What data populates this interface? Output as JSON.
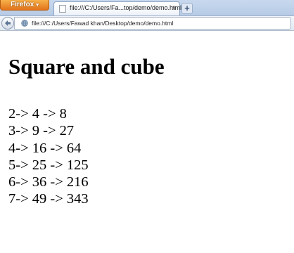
{
  "browser": {
    "menu_button": {
      "label": "Firefox",
      "arrow": "▾",
      "color": "#e8821f"
    },
    "tabs": [
      {
        "label": "file:///C:/Users/Fa...top/demo/demo.html",
        "close_glyph": "×",
        "active": true
      }
    ],
    "new_tab_glyph": "+",
    "address_bar": {
      "back_icon": "back-arrow-icon",
      "site_icon": "globe-icon",
      "url": "file:///C:/Users/Fawad khan/Desktop/demo/demo.html"
    }
  },
  "page": {
    "title": "Square and cube",
    "lines": [
      "2-> 4 -> 8",
      "3-> 9 -> 27",
      "4-> 16 -> 64",
      "5-> 25 -> 125",
      "6-> 36 -> 216",
      "7-> 49 -> 343"
    ]
  }
}
